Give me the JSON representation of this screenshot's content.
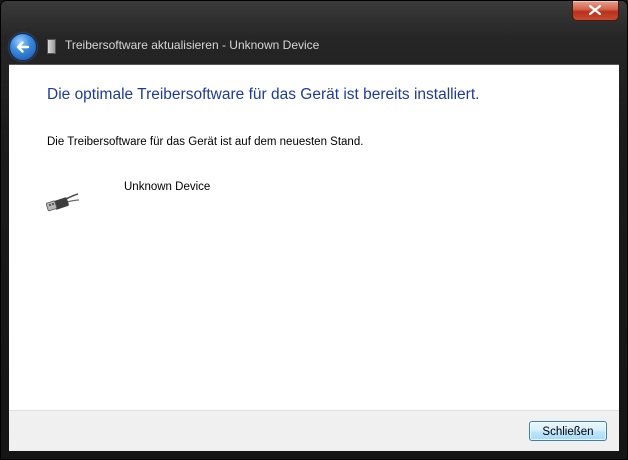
{
  "window": {
    "title": "Treibersoftware aktualisieren - Unknown Device"
  },
  "content": {
    "heading": "Die optimale Treibersoftware für das Gerät ist bereits installiert.",
    "description": "Die Treibersoftware für das Gerät ist auf dem neuesten Stand.",
    "device_name": "Unknown Device"
  },
  "footer": {
    "close_button_label": "Schließen"
  },
  "icons": {
    "back": "back-arrow-icon",
    "window_icon": "driver-icon",
    "close": "close-icon",
    "device": "usb-plug-icon"
  },
  "colors": {
    "heading": "#1e3b9b",
    "close_button": "#c94a31",
    "back_button": "#3b8be0"
  }
}
